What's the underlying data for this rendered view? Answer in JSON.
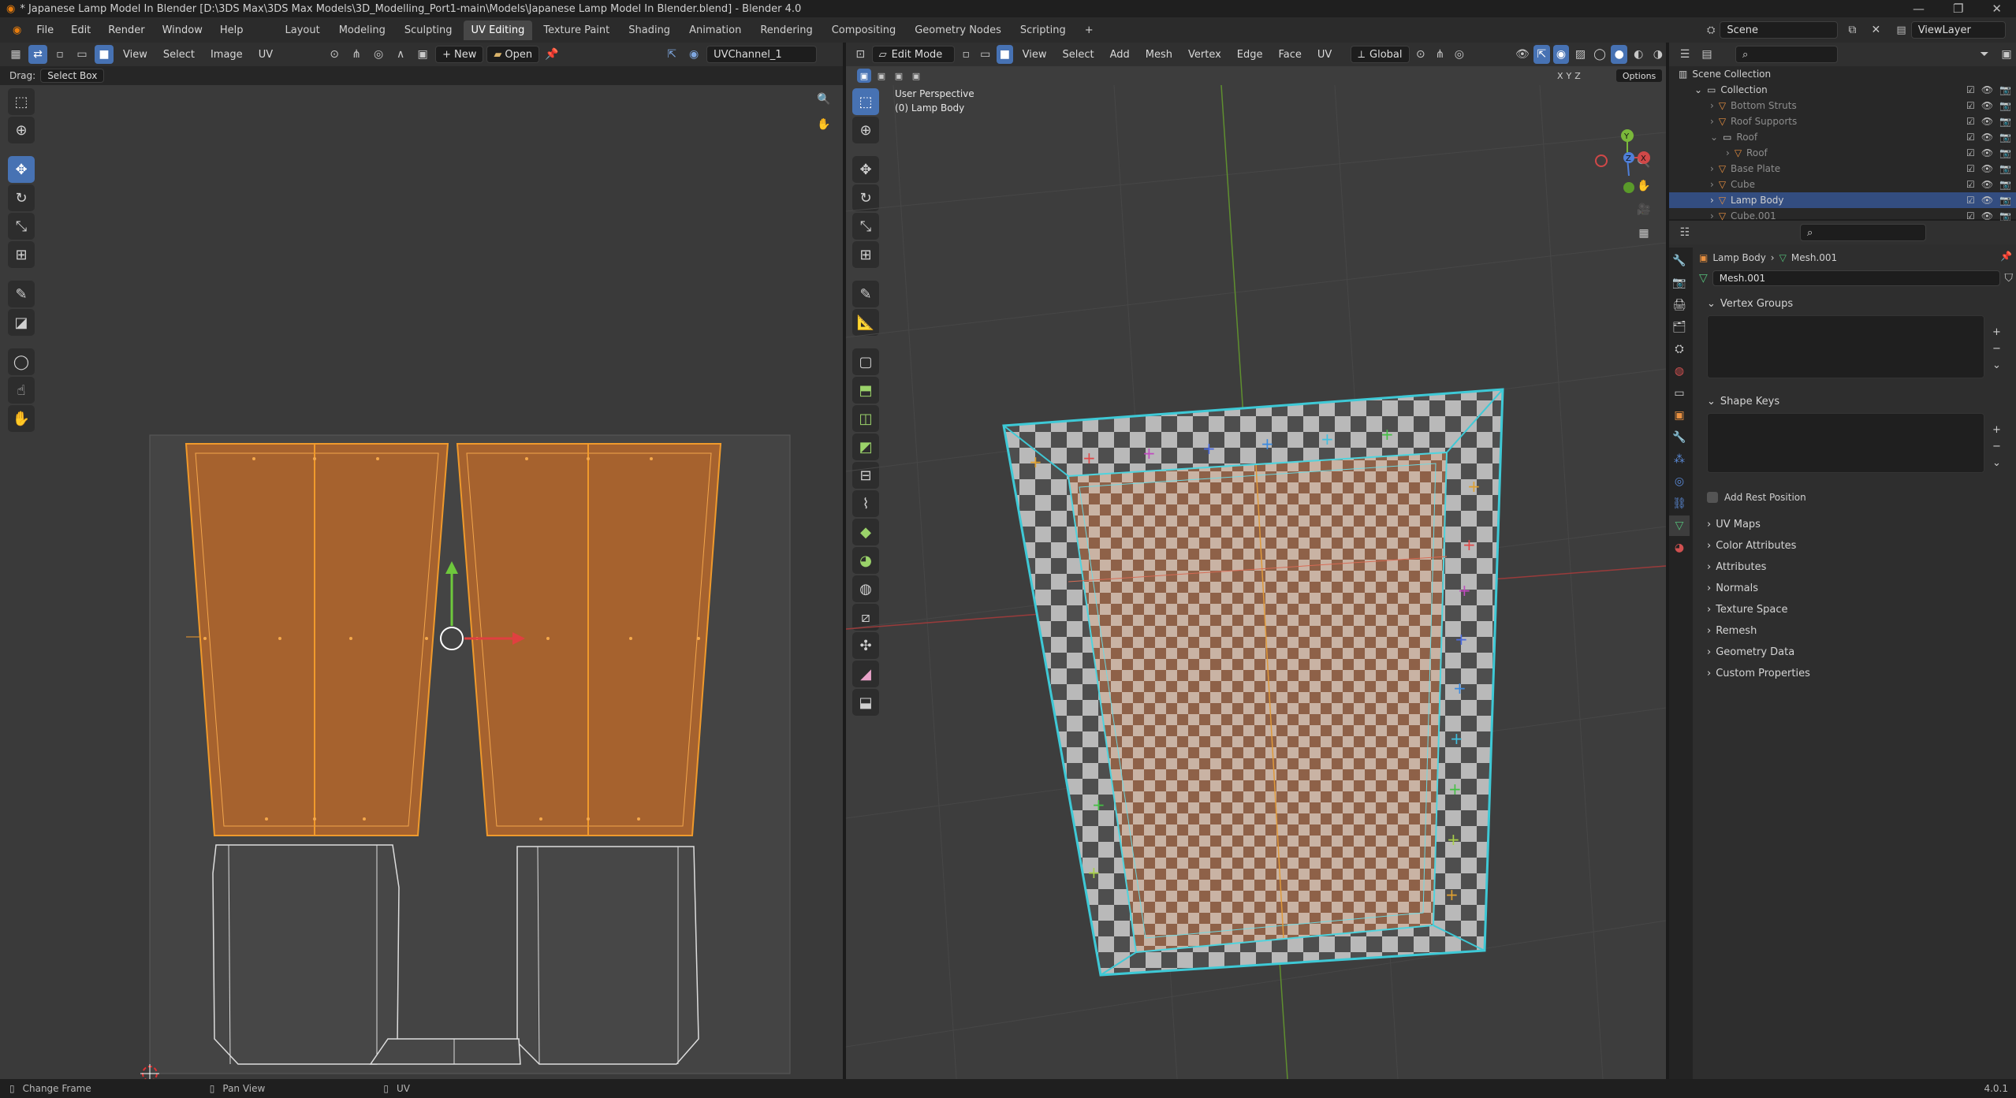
{
  "window": {
    "title": "* Japanese Lamp Model In Blender [D:\\3DS Max\\3DS Max Models\\3D_Modelling_Port1-main\\Models\\Japanese Lamp Model In Blender.blend] - Blender 4.0",
    "controls": [
      "—",
      "❐",
      "✕"
    ]
  },
  "menu": {
    "items": [
      "File",
      "Edit",
      "Render",
      "Window",
      "Help"
    ]
  },
  "workspaces": {
    "tabs": [
      "Layout",
      "Modeling",
      "Sculpting",
      "UV Editing",
      "Texture Paint",
      "Shading",
      "Animation",
      "Rendering",
      "Compositing",
      "Geometry Nodes",
      "Scripting"
    ],
    "active": "UV Editing",
    "add": "+"
  },
  "scene": {
    "name": "Scene",
    "view_layer": "ViewLayer"
  },
  "uv_editor": {
    "menus": [
      "View",
      "Select",
      "Image",
      "UV"
    ],
    "new_label": "New",
    "open_label": "Open",
    "uv_map": "UVChannel_1",
    "drag_label": "Drag:",
    "drag_value": "Select Box"
  },
  "viewport": {
    "mode": "Edit Mode",
    "menus": [
      "View",
      "Select",
      "Add",
      "Mesh",
      "Vertex",
      "Edge",
      "Face",
      "UV"
    ],
    "orientation": "Global",
    "overlay_text_1": "User Perspective",
    "overlay_text_2": "(0) Lamp Body",
    "options_label": "Options",
    "axis_buttons": [
      "X",
      "Y",
      "Z"
    ]
  },
  "outliner": {
    "root": "Scene Collection",
    "rows": [
      {
        "label": "Collection",
        "indent": 1,
        "state": "normal"
      },
      {
        "label": "Bottom Struts",
        "indent": 2,
        "state": "dim"
      },
      {
        "label": "Roof Supports",
        "indent": 2,
        "state": "dim"
      },
      {
        "label": "Roof",
        "indent": 2,
        "state": "dim"
      },
      {
        "label": "Roof",
        "indent": 3,
        "state": "dim"
      },
      {
        "label": "Base Plate",
        "indent": 2,
        "state": "dim"
      },
      {
        "label": "Cube",
        "indent": 2,
        "state": "dim"
      },
      {
        "label": "Lamp Body",
        "indent": 2,
        "state": "selected"
      },
      {
        "label": "Cube.001",
        "indent": 2,
        "state": "dim"
      }
    ]
  },
  "properties": {
    "breadcrumb_object": "Lamp Body",
    "breadcrumb_mesh": "Mesh.001",
    "mesh_name": "Mesh.001",
    "vertex_groups": "Vertex Groups",
    "shape_keys": "Shape Keys",
    "add_rest_position": "Add Rest Position",
    "sections": [
      "UV Maps",
      "Color Attributes",
      "Attributes",
      "Normals",
      "Texture Space",
      "Remesh",
      "Geometry Data",
      "Custom Properties"
    ]
  },
  "statusbar": {
    "left": "Change Frame",
    "middle": "Pan View",
    "right": "UV",
    "version": "4.0.1"
  },
  "colors": {
    "accent": "#4772b3",
    "uv_island": "#b0652e",
    "uv_edge": "#f09a2c",
    "mesh_select": "#3ec9d6",
    "checker_dark": "#4a4a4a",
    "checker_light": "#b8b8b8"
  }
}
